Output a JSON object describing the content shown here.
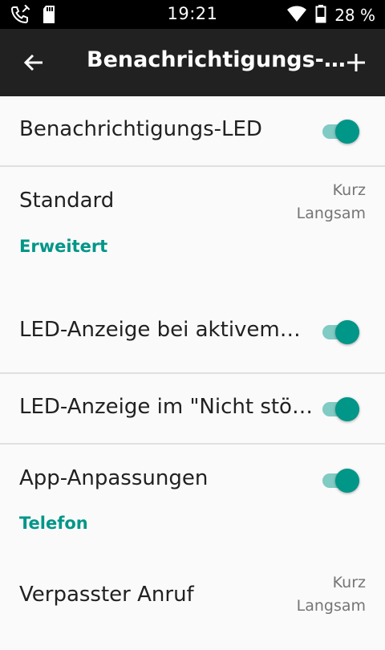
{
  "statusbar": {
    "time": "19:21",
    "battery": "28 %",
    "icons": [
      "phone-call-icon",
      "sd-card-icon",
      "wifi-icon",
      "battery-icon"
    ]
  },
  "appbar": {
    "title": "Benachrichtigungs-…",
    "back_icon": "arrow-back-icon",
    "add_icon": "plus-icon"
  },
  "rows": {
    "notification_led": {
      "label": "Benachrichtigungs-LED",
      "enabled": true
    },
    "standard": {
      "label": "Standard",
      "summary_line1": "Kurz",
      "summary_line2": "Langsam"
    },
    "section_erweitert": "Erweitert",
    "led_active_call": {
      "label": "LED-Anzeige bei aktivem…",
      "enabled": true
    },
    "led_dnd": {
      "label": "LED-Anzeige im \"Nicht stö…",
      "enabled": true
    },
    "app_customizations": {
      "label": "App-Anpassungen",
      "enabled": true
    },
    "section_telefon": "Telefon",
    "missed_call": {
      "label": "Verpasster Anruf",
      "summary_line1": "Kurz",
      "summary_line2": "Langsam"
    }
  },
  "colors": {
    "accent": "#009688",
    "track": "#80cbc4",
    "appbar": "#212121",
    "statusbar": "#000000"
  }
}
